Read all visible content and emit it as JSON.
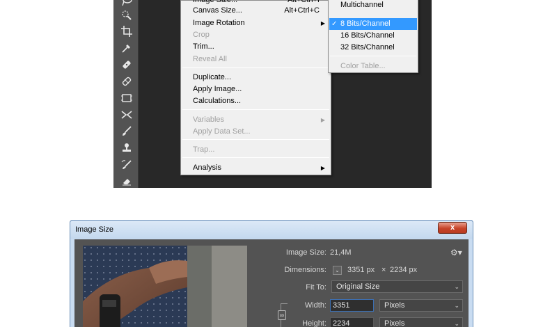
{
  "image_menu": {
    "items": [
      {
        "label": "Image Size...",
        "shortcut": "Alt+Ctrl+I",
        "disabled": false
      },
      {
        "label": "Canvas Size...",
        "shortcut": "Alt+Ctrl+C",
        "disabled": false
      },
      {
        "label": "Image Rotation",
        "shortcut": "",
        "disabled": false,
        "submenu": true
      },
      {
        "label": "Crop",
        "shortcut": "",
        "disabled": true
      },
      {
        "label": "Trim...",
        "shortcut": "",
        "disabled": false
      },
      {
        "label": "Reveal All",
        "shortcut": "",
        "disabled": true
      },
      {
        "label": "Duplicate...",
        "shortcut": "",
        "disabled": false
      },
      {
        "label": "Apply Image...",
        "shortcut": "",
        "disabled": false
      },
      {
        "label": "Calculations...",
        "shortcut": "",
        "disabled": false
      },
      {
        "label": "Variables",
        "shortcut": "",
        "disabled": true,
        "submenu": true
      },
      {
        "label": "Apply Data Set...",
        "shortcut": "",
        "disabled": true
      },
      {
        "label": "Trap...",
        "shortcut": "",
        "disabled": true
      },
      {
        "label": "Analysis",
        "shortcut": "",
        "disabled": false,
        "submenu": true
      }
    ]
  },
  "mode_submenu": {
    "items": [
      {
        "label": "Multichannel",
        "selected": false,
        "disabled": false
      },
      {
        "label": "8 Bits/Channel",
        "selected": true,
        "disabled": false
      },
      {
        "label": "16 Bits/Channel",
        "selected": false,
        "disabled": false
      },
      {
        "label": "32 Bits/Channel",
        "selected": false,
        "disabled": false
      },
      {
        "label": "Color Table...",
        "selected": false,
        "disabled": true
      }
    ],
    "check_mark": "✓"
  },
  "toolbar": {
    "tools": [
      "lasso-icon",
      "quick-selection-icon",
      "crop-icon",
      "eyedropper-icon",
      "healing-brush-icon",
      "patch-icon",
      "frame-icon",
      "content-aware-move-icon",
      "brush-icon",
      "clone-stamp-icon",
      "history-brush-icon",
      "eraser-icon"
    ]
  },
  "dialog": {
    "title": "Image Size",
    "close_label": "x",
    "image_size_label": "Image Size:",
    "image_size_value": "21,4M",
    "dimensions_label": "Dimensions:",
    "dimensions_width": "3351 px",
    "dimensions_times": "×",
    "dimensions_height": "2234 px",
    "fit_to_label": "Fit To:",
    "fit_to_value": "Original Size",
    "width_label": "Width:",
    "width_value": "3351",
    "width_unit": "Pixels",
    "height_label": "Height:",
    "height_value": "2234",
    "height_unit": "Pixels",
    "gear_glyph": "⚙",
    "caret": "⌄",
    "dimensions_caret": "⌄"
  },
  "colors": {
    "ps_background": "#282828",
    "menu_background": "#f0f0f0",
    "selection_blue": "#3399ff",
    "dialog_body": "#535353"
  }
}
